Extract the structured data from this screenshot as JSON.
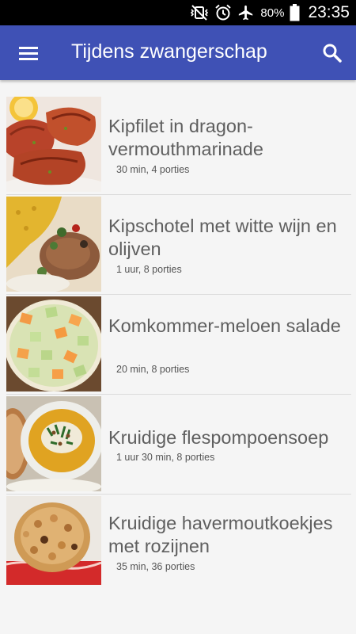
{
  "status_bar": {
    "battery": "80%",
    "time": "23:35",
    "icons": [
      "mute-vibrate-icon",
      "alarm-icon",
      "airplane-mode-icon",
      "battery-icon"
    ]
  },
  "app_bar": {
    "title": "Tijdens zwangerschap",
    "menu_icon": "hamburger-menu-icon",
    "search_icon": "search-icon",
    "color": "#3f51b5"
  },
  "recipes": [
    {
      "title": "Kipfilet in dragon-vermouthmarinade",
      "meta": "30 min, 4 porties",
      "image": "grilled-chicken"
    },
    {
      "title": "Kipschotel met witte wijn en olijven",
      "meta": "1 uur, 8 porties",
      "image": "chicken-rice-dish"
    },
    {
      "title": "Komkommer-meloen salade",
      "meta": "20 min, 8 porties",
      "image": "melon-cucumber-salad"
    },
    {
      "title": "Kruidige flespompoensoep",
      "meta": "1 uur 30 min, 8 porties",
      "image": "pumpkin-soup"
    },
    {
      "title": "Kruidige havermoutkoekjes met rozijnen",
      "meta": "35 min, 36 porties",
      "image": "oatmeal-cookies"
    }
  ]
}
